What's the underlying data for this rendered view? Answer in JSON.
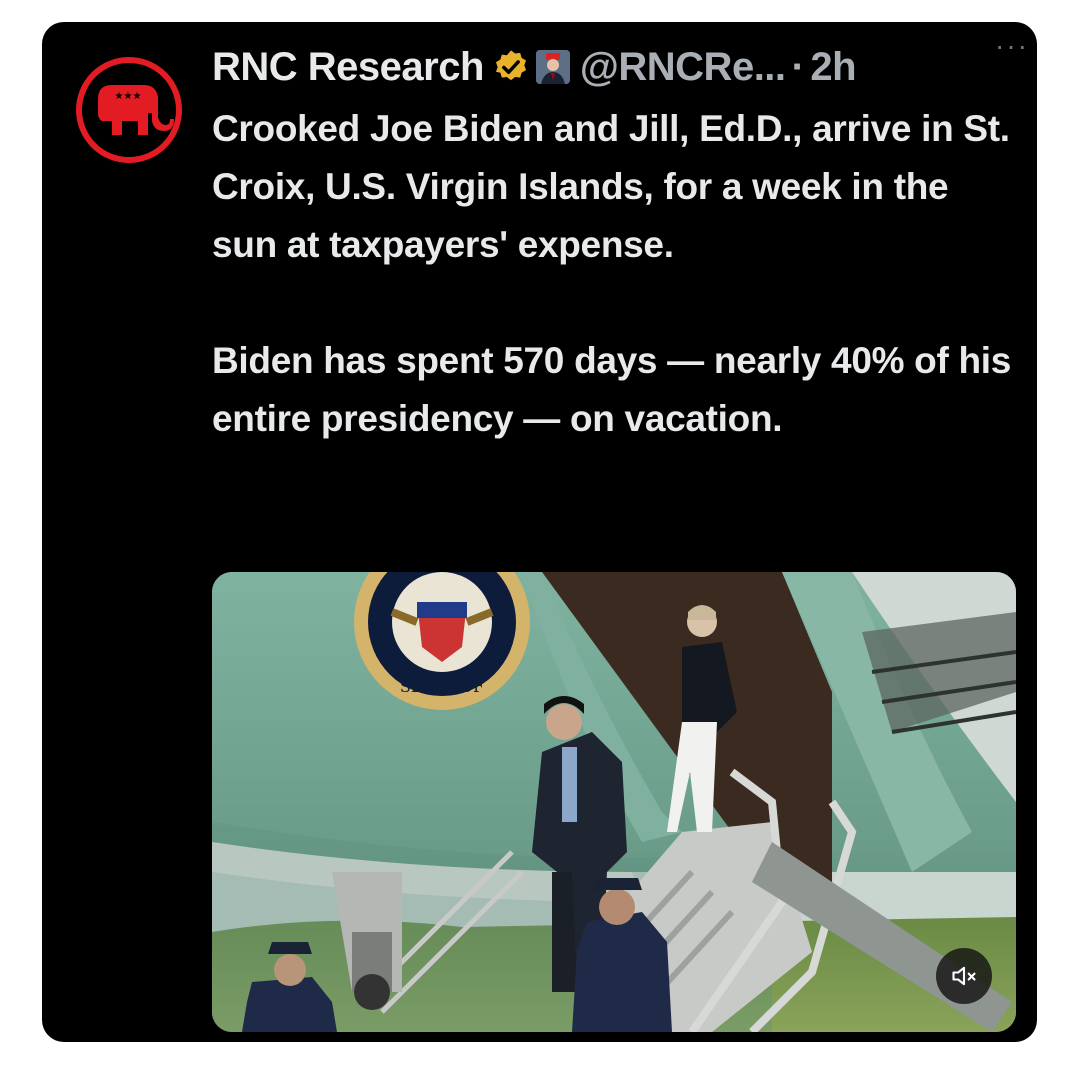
{
  "tweet": {
    "display_name": "RNC Research",
    "handle": "@RNCRe...",
    "separator": "·",
    "time": "2h",
    "more_label": "···",
    "paragraphs": [
      "Crooked Joe Biden and Jill, Ed.D., arrive in St. Croix, U.S. Virgin Islands, for a week in the sun at taxpayers' expense.",
      "Biden has spent 570 days — nearly 40% of his entire presidency — on vacation."
    ],
    "media": {
      "seal_text": "SEAL OF THE PRESIDENT OF THE UNITED STATES"
    }
  },
  "icons": {
    "avatar": "rnc-elephant-logo",
    "verified": "verified-badge-icon",
    "affiliation": "affiliation-avatar-icon",
    "mute": "mute-icon"
  },
  "colors": {
    "background": "#000000",
    "text": "#e7e9ea",
    "muted": "#a9afb4",
    "rnc_red": "#e31b23",
    "verified_gold": "#e8b32a"
  }
}
